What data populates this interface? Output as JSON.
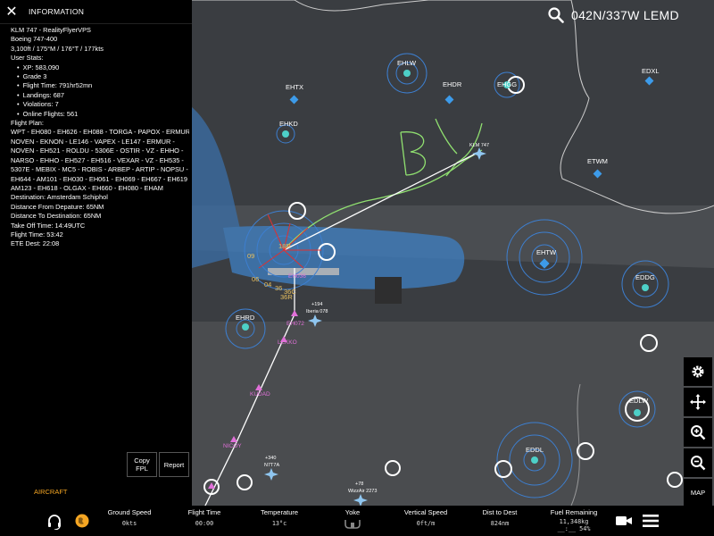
{
  "info_panel": {
    "title": "INFORMATION",
    "lines": [
      "KLM 747 - RealityFlyerVPS",
      "Boeing 747-400",
      "3,100ft / 175°M / 176°T / 177kts",
      "User Stats:"
    ],
    "user_stats": [
      "XP: 583,090",
      "Grade 3",
      "Flight Time: 791hr52mn",
      "Landings: 687",
      "Violations: 7",
      "Online Flights: 561"
    ],
    "flight_plan_label": "Flight Plan:",
    "flight_plan_lines": [
      "WPT - EH080 - EH626 - EH088 - TORGA - PAPOX - ERMUR",
      "NOVEN - EKNON - LE146 - VAPEX - LE147 - ERMUR -",
      "NOVEN - EH521 - ROLDU - 5306E - OSTIR - VZ - EHHO -",
      "NARSO - EHHO - EH527 - EH516 - VEXAR - VZ - EH535 -",
      "5307E - MEBIX - MC5 - ROBIS - ARBEP - ARTIP - NOPSU -",
      "EH644 - AM101 - EH030 - EH061 - EH069 - EH667 - EH619 -",
      "AM123 - EH618 - OLGAX - EH660 - EH080 - EHAM"
    ],
    "details": [
      "Destination: Amsterdam Schiphol",
      "Distance From Depature: 65NM",
      "Distance To Destination: 65NM",
      "Take Off Time: 14:49UTC",
      "Flight Time: 53:42",
      "ETE Dest: 22:08"
    ],
    "copy_fpl_label": "Copy FPL",
    "report_label": "Report",
    "aircraft_tab": "AIRCRAFT"
  },
  "search": {
    "text": "042N/337W LEMD"
  },
  "map": {
    "airports": [
      "EHLW",
      "EHTX",
      "EHDR",
      "EHGG",
      "EDXL",
      "EHKD",
      "ETWM",
      "EHTW",
      "EDDG",
      "EHRD",
      "EDLW",
      "EDDL"
    ],
    "waypoints": [
      "EH072",
      "LEKKO",
      "KUDAD",
      "NICOY",
      "EH036"
    ],
    "aircraft": [
      {
        "callsign": "KLM 747"
      },
      {
        "callsign": "Iberia 078",
        "alt": "+194"
      },
      {
        "callsign": "N7T7A",
        "alt": "+340"
      },
      {
        "callsign": "WizzAir 2273",
        "alt": "+78"
      }
    ],
    "runway_numbers": [
      "09",
      "06",
      "04",
      "36",
      "36R",
      "36C",
      "18R"
    ],
    "drawn_text": "BY"
  },
  "tools": {
    "map_label": "MAP"
  },
  "bottom_bar": {
    "stats": [
      {
        "label": "Ground Speed",
        "value": "0kts"
      },
      {
        "label": "Flight Time",
        "value": "00:00"
      },
      {
        "label": "Temperature",
        "value": "13°c"
      },
      {
        "label": "Yoke",
        "value": ""
      },
      {
        "label": "Vertical Speed",
        "value": "0ft/m"
      },
      {
        "label": "Dist to Dest",
        "value": "824nm"
      },
      {
        "label": "Fuel Remaining",
        "value": "11,348kg"
      }
    ],
    "fuel_sub": "__:__ 54%"
  },
  "colors": {
    "accent": "#f5a623",
    "route": "#ffffff",
    "drawn_route": "#90e070",
    "airport_ring": "#3d7fd0",
    "waypoint": "#e070d8"
  }
}
